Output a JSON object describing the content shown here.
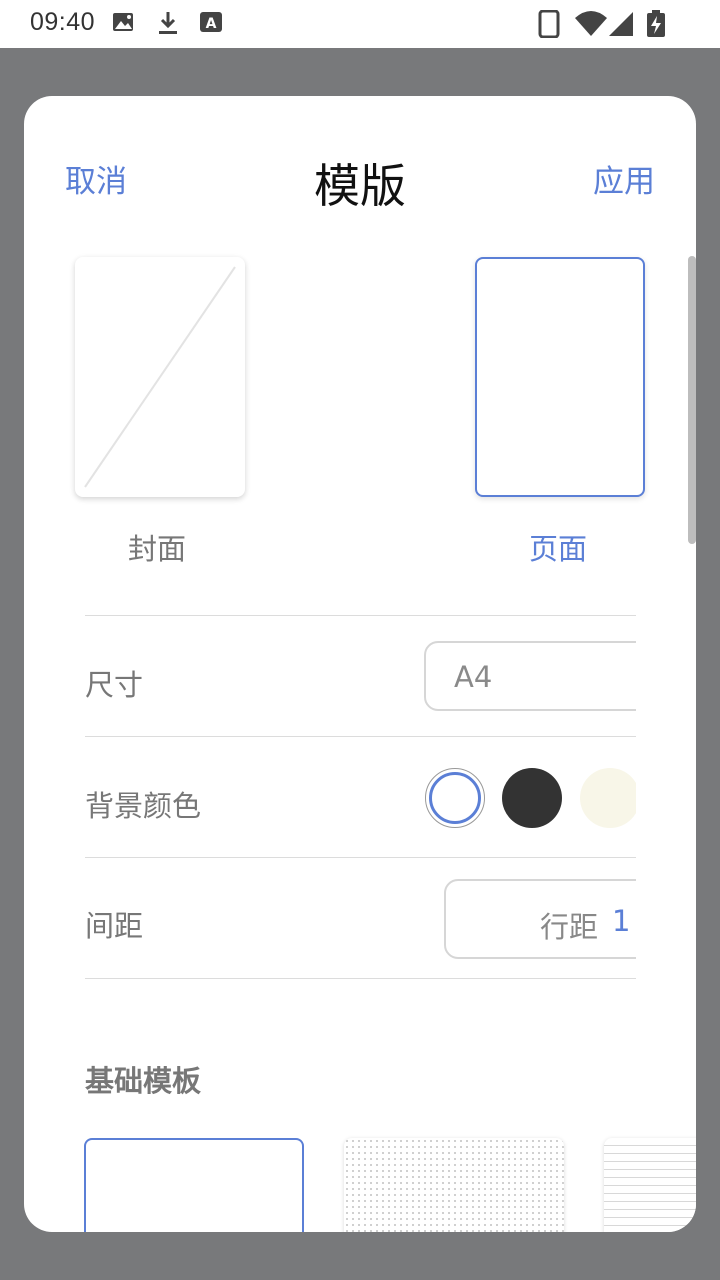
{
  "status_bar": {
    "time": "09:40",
    "left_icons": [
      "gallery-icon",
      "download-icon",
      "font-a-icon"
    ],
    "right_icons": [
      "phone-icon",
      "wifi-icon",
      "signal-icon",
      "battery-charging-icon"
    ]
  },
  "dialog": {
    "cancel_label": "取消",
    "title": "模版",
    "apply_label": "应用",
    "previews": {
      "cover_label": "封面",
      "page_label": "页面",
      "selected": "page"
    },
    "size": {
      "label": "尺寸",
      "value": "A4"
    },
    "background": {
      "label": "背景颜色",
      "swatches": [
        "#ffffff",
        "#333333",
        "#f8f6e8"
      ],
      "selected": "#ffffff"
    },
    "spacing": {
      "label": "间距",
      "key": "行距",
      "value": "1"
    },
    "base_templates": {
      "title": "基础模板",
      "items": [
        "blank",
        "dotted",
        "lined"
      ]
    },
    "accent_color": "#5b7fd6"
  }
}
